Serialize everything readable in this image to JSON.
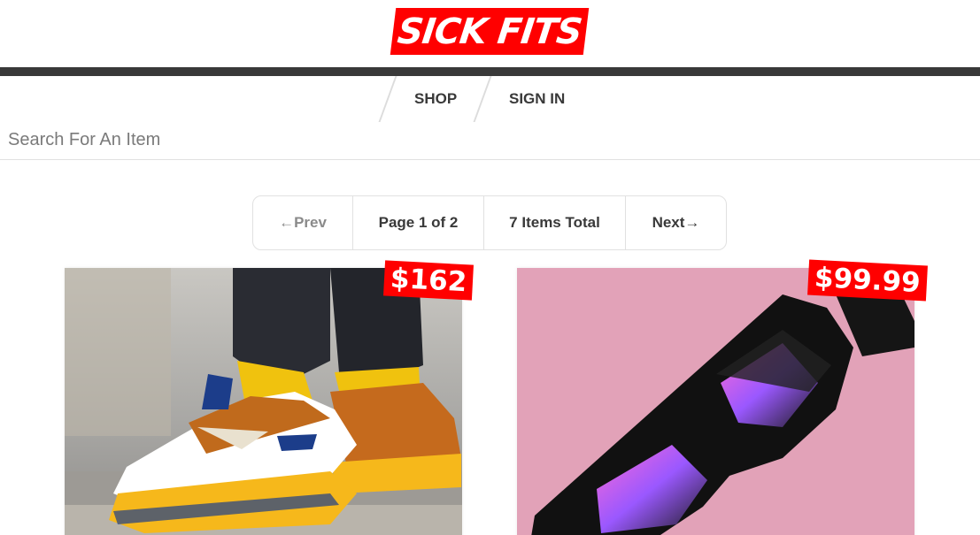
{
  "header": {
    "logo_text": "SICK FITS",
    "brand_color": "#ff0000",
    "bar_color": "#393939"
  },
  "nav": {
    "items": [
      {
        "label": "SHOP"
      },
      {
        "label": "SIGN IN"
      }
    ]
  },
  "search": {
    "placeholder": "Search For An Item",
    "value": ""
  },
  "pagination": {
    "prev_label": "←Prev",
    "page_label": "Page 1 of 2",
    "total_label": "7 Items Total",
    "next_label": "Next→"
  },
  "products": [
    {
      "price": "$162",
      "image": "sneakers-photo"
    },
    {
      "price": "$99.99",
      "image": "sunglasses-photo"
    }
  ]
}
